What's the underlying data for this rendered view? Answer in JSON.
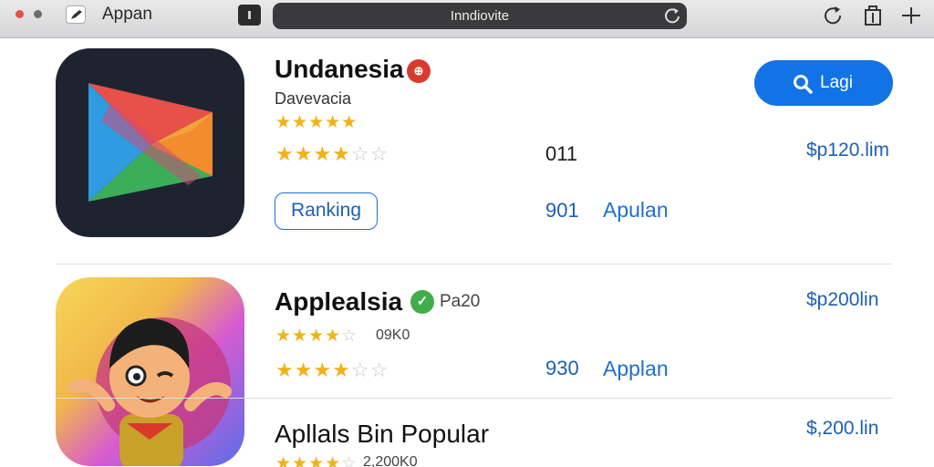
{
  "window": {
    "title": "Appan",
    "url": "Inndiovite"
  },
  "list": [
    {
      "title": "Undanesia",
      "developer": "Davevacia",
      "stars_row1": 5,
      "stars_row2": 4,
      "count_right": "011",
      "button_label": "Ranking",
      "count_blue": "901",
      "link_label": "Apulan",
      "price": "$p120.lim",
      "get_label": "Lagi",
      "badge_symbol": "⊕",
      "badge_color": "#d93a30"
    },
    {
      "title": "Applealsia",
      "tag": "Pa20",
      "ratings_text": "09K0",
      "stars_row1": 4,
      "stars_row2": 4,
      "count_blue": "930",
      "link_label": "Applan",
      "price": "$p200lin",
      "badge_symbol": "✓",
      "badge_color": "#3fae4a"
    },
    {
      "title": "Apllals Bin Popular",
      "ratings_text": "2,200K0",
      "price": "$,200.lin"
    }
  ],
  "colors": {
    "accent": "#1273e6",
    "link": "#1e6fd0",
    "star": "#f0b21a"
  },
  "icons": {
    "app": "pencil-icon",
    "reload": "reload-icon",
    "share": "trash-icon",
    "new_tab": "plus-icon",
    "search": "search-icon"
  }
}
